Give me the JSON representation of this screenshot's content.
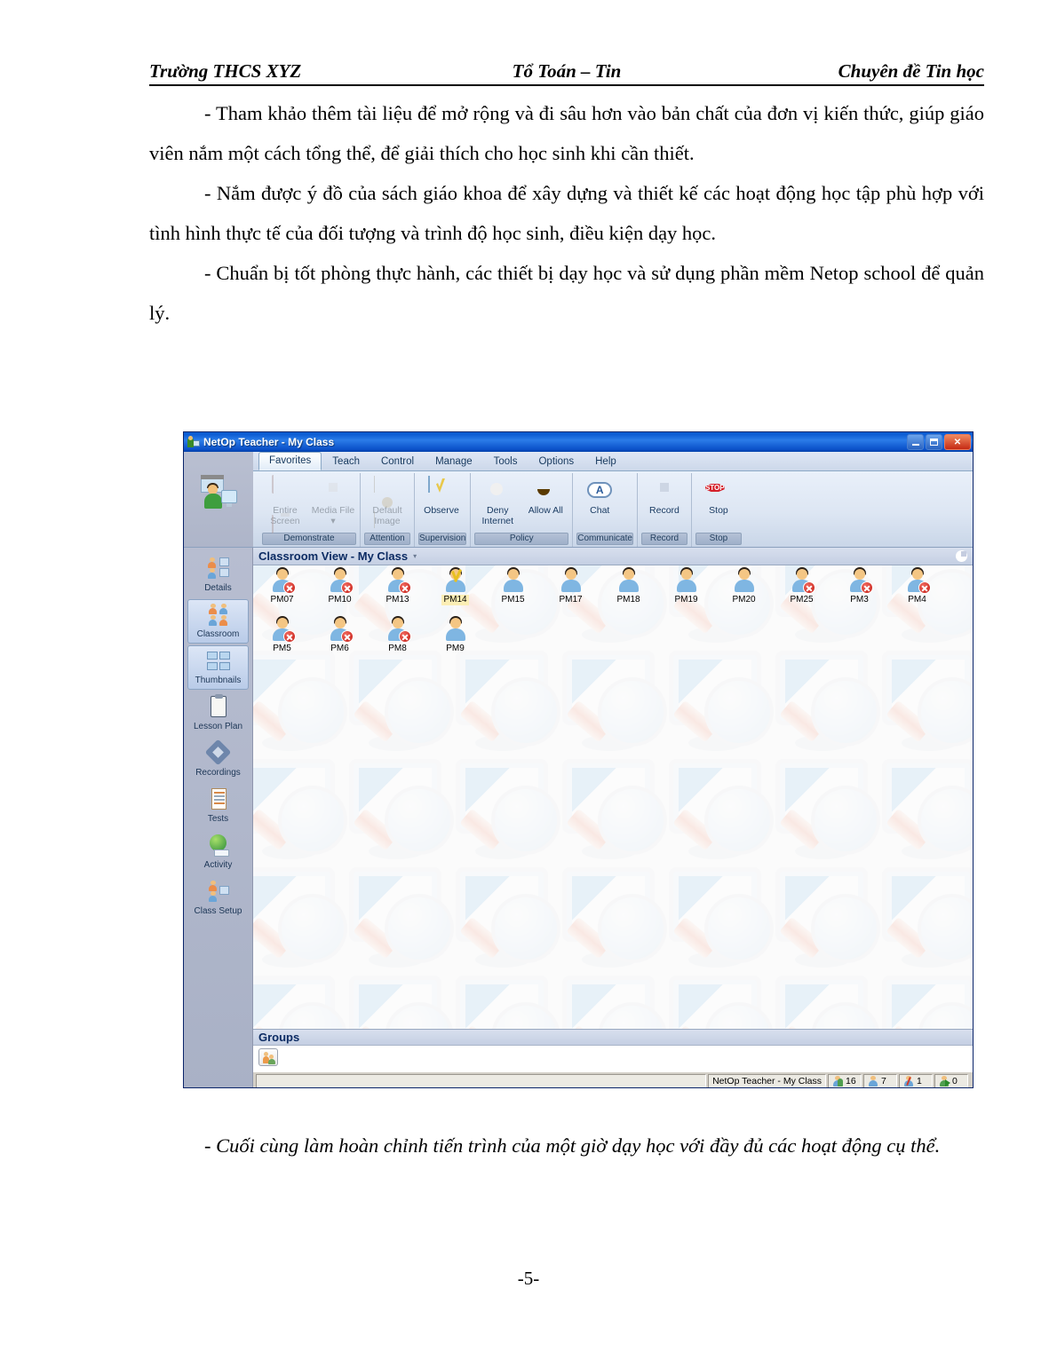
{
  "document": {
    "header": {
      "left": "Trường THCS XYZ",
      "center": "Tổ Toán – Tin",
      "right": "Chuyên đề Tin học"
    },
    "paragraphs": [
      "- Tham khảo thêm tài liệu để mở rộng và đi sâu hơn vào bản chất của đơn vị kiến thức, giúp giáo viên nắm một cách tổng thể, để giải thích cho học sinh khi cần thiết.",
      "- Nắm được ý đồ của sách giáo khoa để xây dựng và thiết kế các hoạt động học tập phù hợp với tình hình thực tế của đối tượng và trình độ học sinh, điều kiện dạy học.",
      "- Chuẩn bị tốt phòng thực hành, các thiết bị dạy học và sử dụng phần mềm Netop school để quản lý."
    ],
    "caption_after": "- Cuối cùng làm hoàn chỉnh tiến trình của một giờ dạy học với đầy đủ các hoạt động cụ thể.",
    "page_number": "-5-"
  },
  "netop": {
    "window": {
      "title": "NetOp Teacher - My Class",
      "icon": "netop-app-icon",
      "buttons": {
        "minimize": "minimize-button",
        "restore": "restore-button",
        "close": "close-button"
      }
    },
    "ribbon": {
      "app_icon": "teacher-monitor-icon",
      "tabs": [
        {
          "label": "Favorites",
          "active": true
        },
        {
          "label": "Teach",
          "active": false
        },
        {
          "label": "Control",
          "active": false
        },
        {
          "label": "Manage",
          "active": false
        },
        {
          "label": "Tools",
          "active": false
        },
        {
          "label": "Options",
          "active": false
        },
        {
          "label": "Help",
          "active": false
        }
      ],
      "groups": [
        {
          "label": "Demonstrate",
          "items": [
            {
              "label": "Entire Screen",
              "icon": "monitor-icon",
              "disabled": true,
              "shape": "ic-screen"
            },
            {
              "label": "Media File ▾",
              "icon": "film-icon",
              "disabled": true,
              "shape": "ic-film"
            }
          ]
        },
        {
          "label": "Attention",
          "items": [
            {
              "label": "Default Image",
              "icon": "picture-icon",
              "disabled": true,
              "shape": "ic-img"
            }
          ]
        },
        {
          "label": "Supervision",
          "items": [
            {
              "label": "Observe",
              "icon": "observe-icon",
              "disabled": false,
              "shape": "ic-observe"
            }
          ]
        },
        {
          "label": "Policy",
          "items": [
            {
              "label": "Deny Internet",
              "icon": "globe-sad-icon",
              "disabled": false,
              "shape": "ic-deny"
            },
            {
              "label": "Allow All",
              "icon": "smiley-icon",
              "disabled": false,
              "shape": "ic-allow"
            }
          ]
        },
        {
          "label": "Communicate",
          "items": [
            {
              "label": "Chat",
              "icon": "chat-icon",
              "disabled": false,
              "shape": "ic-chat"
            }
          ]
        },
        {
          "label": "Record",
          "items": [
            {
              "label": "Record",
              "icon": "record-icon",
              "disabled": false,
              "shape": "ic-record"
            }
          ]
        },
        {
          "label": "Stop",
          "items": [
            {
              "label": "Stop",
              "icon": "stop-sign-icon",
              "disabled": false,
              "shape": "ic-stop",
              "glyph": "STOP"
            }
          ]
        }
      ]
    },
    "sidebar": {
      "items": [
        {
          "label": "Details",
          "icon": "details-icon",
          "selected": false
        },
        {
          "label": "Classroom",
          "icon": "classroom-icon",
          "selected": true
        },
        {
          "label": "Thumbnails",
          "icon": "thumbnails-icon",
          "selected": false
        },
        {
          "label": "Lesson Plan",
          "icon": "clipboard-icon",
          "selected": false
        },
        {
          "label": "Recordings",
          "icon": "recordings-icon",
          "selected": false
        },
        {
          "label": "Tests",
          "icon": "tests-icon",
          "selected": false
        },
        {
          "label": "Activity",
          "icon": "activity-icon",
          "selected": false
        },
        {
          "label": "Class Setup",
          "icon": "class-setup-icon",
          "selected": false
        }
      ]
    },
    "classroom_view": {
      "title": "Classroom View - My Class",
      "caret": "▾",
      "clock_icon": "clock-icon",
      "rows": [
        [
          {
            "name": "PM07",
            "status": "offline",
            "highlight": false
          },
          {
            "name": "PM10",
            "status": "offline",
            "highlight": false
          },
          {
            "name": "PM13",
            "status": "offline",
            "highlight": false
          },
          {
            "name": "PM14",
            "status": "marked",
            "highlight": true
          },
          {
            "name": "PM15",
            "status": "online",
            "highlight": false
          },
          {
            "name": "PM17",
            "status": "online",
            "highlight": false
          },
          {
            "name": "PM18",
            "status": "online",
            "highlight": false
          },
          {
            "name": "PM19",
            "status": "online",
            "highlight": false
          },
          {
            "name": "PM20",
            "status": "online",
            "highlight": false
          },
          {
            "name": "PM25",
            "status": "offline",
            "highlight": false
          },
          {
            "name": "PM3",
            "status": "offline",
            "highlight": false
          },
          {
            "name": "PM4",
            "status": "offline",
            "highlight": false
          }
        ],
        [
          {
            "name": "PM5",
            "status": "offline",
            "highlight": false
          },
          {
            "name": "PM6",
            "status": "offline",
            "highlight": false
          },
          {
            "name": "PM8",
            "status": "offline",
            "highlight": false
          },
          {
            "name": "PM9",
            "status": "online",
            "highlight": false
          }
        ]
      ]
    },
    "groups_pane": {
      "title": "Groups",
      "chip_icon": "group-icon"
    },
    "statusbar": {
      "label": "NetOp Teacher - My Class",
      "counts": [
        {
          "icon": "students-total-icon",
          "value": "16"
        },
        {
          "icon": "students-online-icon",
          "value": "7"
        },
        {
          "icon": "students-marked-icon",
          "value": "1"
        },
        {
          "icon": "students-active-icon",
          "value": "0"
        }
      ]
    }
  },
  "colors": {
    "titlebar_blue": "#0a5ad2",
    "accent_navy": "#0c2b63",
    "ribbon_light": "#e9f0fa",
    "sidebar_grey": "#b0b8cb",
    "status_red": "#c41a12",
    "mark_yellow": "#e8c020"
  }
}
